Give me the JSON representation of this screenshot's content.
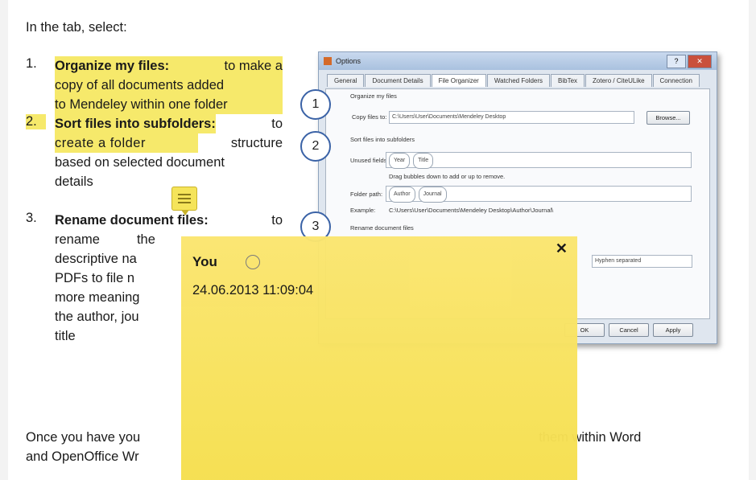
{
  "intro": "In the tab, select:",
  "items": [
    {
      "num": "1.",
      "lines": [
        {
          "parts": [
            {
              "t": "Organize my files:",
              "b": true,
              "hl": true
            },
            {
              "t": " to make a",
              "hl": true
            }
          ]
        },
        {
          "parts": [
            {
              "t": "copy of all documents added",
              "hl": true
            }
          ]
        },
        {
          "parts": [
            {
              "t": "to Mendeley within one folder",
              "hl": true
            }
          ]
        }
      ]
    },
    {
      "num": "2.",
      "lines": [
        {
          "parts": [
            {
              "t": "Sort files into subfolders:",
              "b": true,
              "hl": true
            },
            {
              "t": " to"
            }
          ]
        },
        {
          "parts": [
            {
              "t": "create a folder",
              "hl": true
            },
            {
              "t": "structure"
            }
          ]
        },
        {
          "parts": [
            {
              "t": "based on selected document"
            }
          ]
        },
        {
          "parts": [
            {
              "t": "details"
            }
          ]
        }
      ]
    },
    {
      "num": "3.",
      "lines": [
        {
          "parts": [
            {
              "t": "Rename document files:",
              "b": true
            },
            {
              "t": " to"
            }
          ]
        },
        {
          "parts": [
            {
              "t": "rename"
            },
            {
              "t": "the"
            }
          ]
        },
        {
          "parts": [
            {
              "t": "descriptive na"
            }
          ]
        },
        {
          "parts": [
            {
              "t": "PDFs to file n"
            }
          ]
        },
        {
          "parts": [
            {
              "t": "more meaning"
            }
          ]
        },
        {
          "parts": [
            {
              "t": "the author, jou"
            }
          ]
        },
        {
          "parts": [
            {
              "t": "title"
            }
          ]
        }
      ]
    }
  ],
  "footer": {
    "line1a": "Once you have you",
    "line1b": "them within Word",
    "line2": "and OpenOffice Wr"
  },
  "dialog": {
    "title": "Options",
    "tabs": [
      "General",
      "Document Details",
      "File Organizer",
      "Watched Folders",
      "BibTex",
      "Zotero / CiteULike",
      "Connection"
    ],
    "active_tab": "File Organizer",
    "organize_label": "Organize my files",
    "copy_label": "Copy files to:",
    "copy_path": "C:\\Users\\User\\Documents\\Mendeley Desktop",
    "browse": "Browse...",
    "sort_label": "Sort files into subfolders",
    "unused_label": "Unused fields:",
    "unused_fields": [
      "Year",
      "Title"
    ],
    "drag_hint": "Drag bubbles down to add or up to remove.",
    "folder_label": "Folder path:",
    "folder_fields": [
      "Author",
      "Journal"
    ],
    "example_label": "Example:",
    "example_path": "C:\\Users\\User\\Documents\\Mendeley Desktop\\Author\\Journal\\",
    "rename_label": "Rename document files",
    "separator": "Hyphen separated",
    "ok": "OK",
    "cancel": "Cancel",
    "apply": "Apply"
  },
  "callouts": [
    "1",
    "2",
    "3"
  ],
  "note": {
    "author": "You",
    "datetime": "24.06.2013 11:09:04",
    "close": "✕"
  }
}
